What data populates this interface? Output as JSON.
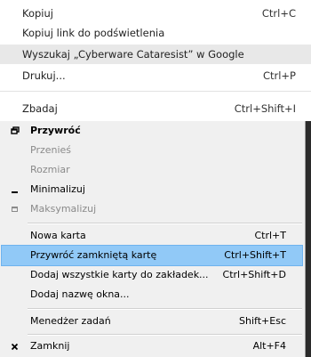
{
  "context_menu": {
    "items": [
      {
        "label": "Kopiuj",
        "shortcut": "Ctrl+C"
      },
      {
        "label": "Kopiuj link do podświetlenia",
        "shortcut": ""
      },
      {
        "label": "Wyszukaj „Cyberware Cataresist” w Google",
        "shortcut": ""
      },
      {
        "label": "Drukuj...",
        "shortcut": "Ctrl+P"
      },
      {
        "label": "Zbadaj",
        "shortcut": "Ctrl+Shift+I"
      }
    ]
  },
  "system_menu": {
    "items": [
      {
        "label": "Przywróć",
        "shortcut": "",
        "icon": "restore-icon"
      },
      {
        "label": "Przenieś",
        "shortcut": ""
      },
      {
        "label": "Rozmiar",
        "shortcut": ""
      },
      {
        "label": "Minimalizuj",
        "shortcut": "",
        "icon": "minimize-icon"
      },
      {
        "label": "Maksymalizuj",
        "shortcut": "",
        "icon": "maximize-icon"
      },
      {
        "label": "Nowa karta",
        "shortcut": "Ctrl+T"
      },
      {
        "label": "Przywróć zamkniętą kartę",
        "shortcut": "Ctrl+Shift+T"
      },
      {
        "label": "Dodaj wszystkie karty do zakładek...",
        "shortcut": "Ctrl+Shift+D"
      },
      {
        "label": "Dodaj nazwę okna...",
        "shortcut": ""
      },
      {
        "label": "Menedżer zadań",
        "shortcut": "Shift+Esc"
      },
      {
        "label": "Zamknij",
        "shortcut": "Alt+F4",
        "icon": "close-icon"
      }
    ]
  }
}
